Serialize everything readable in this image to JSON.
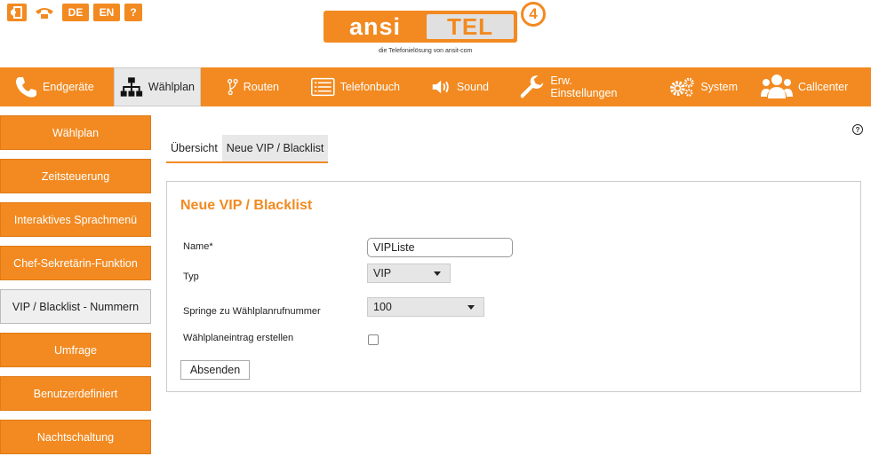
{
  "topicons": {
    "lang_de": "DE",
    "lang_en": "EN",
    "help": "?"
  },
  "logo": {
    "left_text": "ansi",
    "right_text": "TEL",
    "version": "4",
    "tagline": "die Telefonielösung von ansit-com"
  },
  "nav": {
    "items": [
      {
        "label": "Endgeräte",
        "icon": "phone-icon"
      },
      {
        "label": "Wählplan",
        "icon": "sitemap-icon"
      },
      {
        "label": "Routen",
        "icon": "route-icon"
      },
      {
        "label": "Telefonbuch",
        "icon": "phonebook-icon"
      },
      {
        "label": "Sound",
        "icon": "speaker-icon"
      },
      {
        "label": "Erw. Einstellungen",
        "icon": "wrench-icon"
      },
      {
        "label": "System",
        "icon": "gears-icon"
      },
      {
        "label": "Callcenter",
        "icon": "users-icon"
      }
    ],
    "active": "Wählplan"
  },
  "sidebar": {
    "items": [
      {
        "label": "Wählplan"
      },
      {
        "label": "Zeitsteuerung"
      },
      {
        "label": "Interaktives Sprachmenü"
      },
      {
        "label": "Chef-Sekretärin-Funktion"
      },
      {
        "label": "VIP / Blacklist - Nummern"
      },
      {
        "label": "Umfrage"
      },
      {
        "label": "Benutzerdefiniert"
      },
      {
        "label": "Nachtschaltung"
      }
    ],
    "active": "VIP / Blacklist - Nummern"
  },
  "tabs": {
    "items": [
      {
        "label": "Übersicht"
      },
      {
        "label": "Neue VIP / Blacklist"
      }
    ],
    "active": "Neue VIP / Blacklist"
  },
  "help_icon": "?",
  "form": {
    "title": "Neue VIP / Blacklist",
    "name_label": "Name*",
    "name_value": "VIPListe",
    "type_label": "Typ",
    "type_value": "VIP",
    "jump_label": "Springe zu Wählplanrufnummer",
    "jump_value": "100",
    "create_entry_label": "Wählplaneintrag erstellen",
    "create_entry_checked": false,
    "submit_label": "Absenden"
  },
  "colors": {
    "accent": "#f28a21",
    "active_bg": "#e8e8e8"
  }
}
